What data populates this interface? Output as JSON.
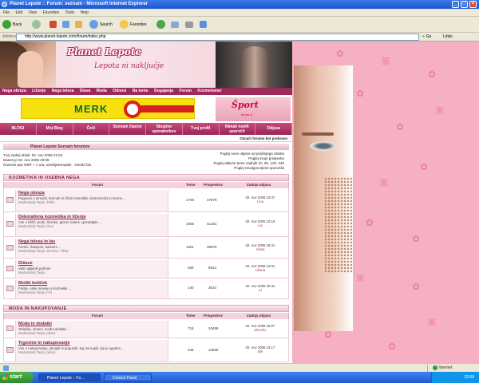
{
  "window": {
    "title": "Planet Lepote :: Forum: seznam - Microsoft Internet Explorer"
  },
  "menu": [
    "File",
    "Edit",
    "View",
    "Favorites",
    "Tools",
    "Help"
  ],
  "toolbar": {
    "back": "Back",
    "search": "Search",
    "favorites": "Favorites"
  },
  "address": {
    "label": "Address",
    "url": "http://www.planet-lepote.com/forum/index.php",
    "go": "Go",
    "links": "Links"
  },
  "site": {
    "logo": "Planet Lepote",
    "slogan": "Lepota ni naključje",
    "nav_top": [
      "Nega obraza",
      "Ličenje",
      "Nega telesa",
      "Diava",
      "Moda",
      "Odnosi",
      "Na tentu",
      "Dogajanja",
      "Forum",
      "Kozmetomer"
    ],
    "ad_left": "MERK",
    "ad_right_title": "Šport",
    "ad_right_sub": "forum.si",
    "nav_bottom": [
      "BLOGI",
      "Moj Blog",
      "Čeči",
      "Seznam članov",
      "Skupine uporabnikov",
      "Tvoj profil",
      "Nimaš novih sporočil",
      "Odjava"
    ],
    "mark_read": "Označi forume kot prebrane",
    "breadcrumb": "Planet Lepote Seznam forumov",
    "info_left": [
      "Tvoj zadnji obisk: 02. nov 2006 21:54",
      "Danes je 02. nov 2006 23:08",
      "Časovni pas GMT + 1 ura, srednjeevropski - zimski čas"
    ],
    "info_right": [
      "Poglej nove objave od prejšnjega obiska",
      "Poglej svoje prispevke",
      "Poglej aktivne teme zadnjih 1h, 6h, 12h, 24h",
      "Poglej neodgovorjene sporočila"
    ]
  },
  "sections": [
    {
      "title": "KOZMETIKA IN OSEBNA NEGA",
      "headers": {
        "forum": "Forum",
        "topics": "Teme",
        "posts": "Prispevkov",
        "last": "Zadnja objava"
      },
      "rows": [
        {
          "name": "Nega obraza",
          "desc": "Pogovori o tonerjih, kremah in izbiri kozmetike, katera koža in krema ...",
          "mods": "Moderatorji Tanja, Tikha",
          "topics": "1730",
          "posts": "47878",
          "last_date": "02. nov 2006 23:47",
          "last_user": "Lina"
        },
        {
          "name": "Dekorativna kozmetika in ličenje",
          "desc": "Vse o ličilih: pudri, šminke, glossi, katere uporabljate ...",
          "mods": "Moderatorji Tanja, Diva",
          "topics": "1055",
          "posts": "41261",
          "last_date": "02. nov 2006 23:15",
          "last_user": "Lia"
        },
        {
          "name": "Nega telesa in las",
          "desc": "Kreme, šamponi, balzami ...",
          "mods": "Moderatorji Tanja, Simona, Tikha",
          "topics": "1251",
          "posts": "39575",
          "last_date": "02. nov 2006 18:41",
          "last_user": "Alana"
        },
        {
          "name": "Dišave",
          "desc": "Vaši najljubši parfumi",
          "mods": "Moderatorji Tanja",
          "topics": "269",
          "posts": "9014",
          "last_date": "02. nov 2006 13:31",
          "last_user": "Liliana"
        },
        {
          "name": "Moški kotiček",
          "desc": "Fantje, vaše mnenje o kozmetiki ...",
          "mods": "Moderatorji Tanja, Fiči",
          "topics": "140",
          "posts": "3034",
          "last_date": "02. nov 2006 20:44",
          "last_user": "LJ"
        }
      ]
    },
    {
      "title": "MODA IN NAKUPOVANJE",
      "headers": {
        "forum": "Forum",
        "topics": "Teme",
        "posts": "Prispevkov",
        "last": "Zadnja objava"
      },
      "rows": [
        {
          "name": "Moda in dodatki",
          "desc": "Oblačila, obutev, modni dodatki ...",
          "mods": "Moderatorji Tanja, pikica",
          "topics": "718",
          "posts": "34486",
          "last_date": "02. nov 2006 15:07",
          "last_user": "Mocoko"
        },
        {
          "name": "Trgovine in nakupovanje",
          "desc": "Vse o nakupovanju, akcijah in popustih, kaj ste kupili, kje je ugodno ...",
          "mods": "Moderatorji Tanja, pikica",
          "topics": "348",
          "posts": "14836",
          "last_date": "02. nov 2006 23:17",
          "last_user": "tyle"
        }
      ]
    }
  ],
  "status": {
    "zone": "Internet"
  },
  "taskbar": {
    "start": "start",
    "tasks": [
      "Planet Lepote :: Fo...",
      "Control Panel"
    ],
    "clock": "23:08"
  }
}
